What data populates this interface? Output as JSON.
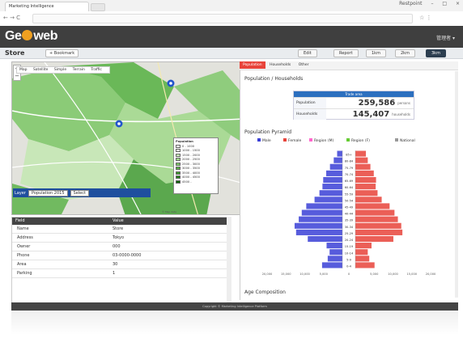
{
  "browser": {
    "tab_title": "Marketing Intelligence",
    "url": "",
    "window_user": "Restpoint",
    "win_min": "–",
    "win_max": "□",
    "win_close": "×",
    "nav": "← → C",
    "right_icons": "☆ ⋮"
  },
  "app": {
    "logo_pre": "Ge",
    "logo_post": "web",
    "logo_sub": "",
    "user": "管理者 ▾"
  },
  "toolbar": {
    "title": "Store",
    "bookmark": "+ Bookmark",
    "buttons": [
      {
        "label": "Edit",
        "active": false
      },
      {
        "label": "Report",
        "active": false
      },
      {
        "label": "1km",
        "active": false
      },
      {
        "label": "2km",
        "active": false
      },
      {
        "label": "3km",
        "active": true
      }
    ]
  },
  "map": {
    "tabs": [
      "Map",
      "Satellite",
      "Simple",
      "Terrain",
      "Traffic"
    ],
    "zoom": "+ −",
    "legend": {
      "title": "Population",
      "colors": [
        "#ffffff",
        "#e8f5e0",
        "#c5e8b4",
        "#a0d88a",
        "#7bc765",
        "#55b041",
        "#3a9a2a",
        "#217f17",
        "#0c6308"
      ],
      "entries": [
        "0 - 1000",
        "1000 - 1500",
        "1500 - 2000",
        "2000 - 2500",
        "2500 - 3000",
        "3000 - 3500",
        "3500 - 4000",
        "4000 - 4500",
        "4500 -"
      ]
    },
    "layer_label": "Layer",
    "layer_select": "Population 2015",
    "layer_select2": "Select",
    "footer": "© Map data"
  },
  "table": {
    "headers": [
      "Field",
      "Value"
    ],
    "rows": [
      {
        "k": "Name",
        "v": "Store"
      },
      {
        "k": "Address",
        "v": "Tokyo"
      },
      {
        "k": "Owner",
        "v": "000"
      },
      {
        "k": "Phone",
        "v": "03-0000-0000"
      },
      {
        "k": "Area",
        "v": "30"
      },
      {
        "k": "Parking",
        "v": "1"
      }
    ]
  },
  "right": {
    "tabs": [
      {
        "label": "Population",
        "active": true
      },
      {
        "label": "Households",
        "active": false
      },
      {
        "label": "Other",
        "active": false
      }
    ],
    "sec1": "Population / Households",
    "pop_header": "Trade area",
    "pop_rows": [
      {
        "label": "Population",
        "value": "259,586",
        "unit": "persons"
      },
      {
        "label": "Households",
        "value": "145,407",
        "unit": "households"
      }
    ],
    "sec2": "Population Pyramid",
    "sec3": "Age Composition"
  },
  "chart_data": {
    "type": "bar",
    "title": "",
    "categories": [
      "0-4",
      "5-9",
      "10-14",
      "15-19",
      "20-24",
      "25-29",
      "30-34",
      "35-39",
      "40-44",
      "45-49",
      "50-54",
      "55-59",
      "60-64",
      "65-69",
      "70-74",
      "75-79",
      "80-84",
      "85+"
    ],
    "series": [
      {
        "name": "Male",
        "values": [
          5400,
          3900,
          3400,
          4200,
          9200,
          12300,
          12700,
          11600,
          10800,
          9600,
          7400,
          6100,
          5300,
          5100,
          4300,
          3300,
          2300,
          1400
        ]
      },
      {
        "name": "Female",
        "values": [
          5100,
          3700,
          3300,
          4300,
          10100,
          12500,
          12200,
          11300,
          10400,
          9100,
          7000,
          5900,
          5400,
          5500,
          4900,
          4000,
          3300,
          2800
        ]
      }
    ],
    "legend": [
      "Male",
      "Female",
      "Region (M)",
      "Region (F)",
      "National"
    ],
    "xlim": [
      -20000,
      20000
    ],
    "x_ticks": [
      "20,000",
      "15,000",
      "10,000",
      "5,000",
      "0",
      "5,000",
      "10,000",
      "15,000",
      "20,000"
    ],
    "colors": {
      "male": "#3a3fd6",
      "female": "#e8433a"
    }
  },
  "footer": "Copyright © Marketing Intelligence Platform",
  "caption": ""
}
